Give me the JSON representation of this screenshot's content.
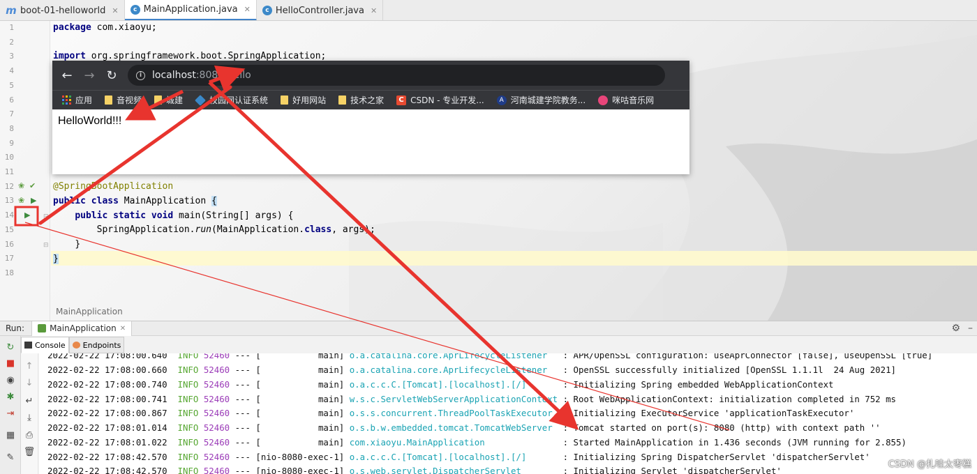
{
  "tabs": [
    {
      "label": "boot-01-helloworld",
      "icon": "maven-module-icon",
      "active": false
    },
    {
      "label": "MainApplication.java",
      "icon": "java-class-icon",
      "active": true
    },
    {
      "label": "HelloController.java",
      "icon": "java-class-icon",
      "active": false
    }
  ],
  "editor": {
    "line_numbers": [
      "1",
      "2",
      "3",
      "4",
      "5",
      "6",
      "7",
      "8",
      "9",
      "10",
      "11",
      "12",
      "13",
      "14",
      "15",
      "16",
      "17",
      "18"
    ],
    "code": {
      "l1_kw": "package",
      "l1_rest": " com.xiaoyu;",
      "l3_kw": "import",
      "l3_rest": " org.springframework.boot.SpringApplication;",
      "l12": "@SpringBootApplication",
      "l13_kw1": "public",
      "l13_kw2": "class",
      "l13_name": " MainApplication ",
      "l13_brace": "{",
      "l14_kw": "public static void",
      "l14_rest": " main(String[] args) {",
      "l15_a": "SpringApplication.",
      "l15_b": "run",
      "l15_c": "(MainApplication.",
      "l15_kw": "class",
      "l15_d": ", args);",
      "l16": "}",
      "l17": "}"
    },
    "breadcrumb": "MainApplication"
  },
  "browser": {
    "url_host": "localhost",
    "url_path": ":8080/hello",
    "bookmarks": [
      "应用",
      "音视频",
      "城建",
      "校园网认证系统",
      "好用网站",
      "技术之家",
      "CSDN - 专业开发...",
      "河南城建学院教务...",
      "咪咕音乐网"
    ],
    "page_text": "HelloWorld!!!"
  },
  "run_panel": {
    "label": "Run:",
    "config_tab": "MainApplication",
    "console_tab": "Console",
    "endpoints_tab": "Endpoints"
  },
  "console": {
    "lines": [
      {
        "ts": "2022-02-22 17:08:00.640",
        "level": "INFO",
        "pid": "52460",
        "sep": " --- [",
        "thread": "           main]",
        "logger": "o.a.catalina.core.AprLifecycleListener  ",
        "msg": " : APR/OpenSSL configuration: useAprConnector [false], useOpenSSL [true]"
      },
      {
        "ts": "2022-02-22 17:08:00.660",
        "level": "INFO",
        "pid": "52460",
        "sep": " --- [",
        "thread": "           main]",
        "logger": "o.a.catalina.core.AprLifecycleListener  ",
        "msg": " : OpenSSL successfully initialized [OpenSSL 1.1.1l  24 Aug 2021]"
      },
      {
        "ts": "2022-02-22 17:08:00.740",
        "level": "INFO",
        "pid": "52460",
        "sep": " --- [",
        "thread": "           main]",
        "logger": "o.a.c.c.C.[Tomcat].[localhost].[/]      ",
        "msg": " : Initializing Spring embedded WebApplicationContext"
      },
      {
        "ts": "2022-02-22 17:08:00.741",
        "level": "INFO",
        "pid": "52460",
        "sep": " --- [",
        "thread": "           main]",
        "logger": "w.s.c.ServletWebServerApplicationContext",
        "msg": " : Root WebApplicationContext: initialization completed in 752 ms"
      },
      {
        "ts": "2022-02-22 17:08:00.867",
        "level": "INFO",
        "pid": "52460",
        "sep": " --- [",
        "thread": "           main]",
        "logger": "o.s.s.concurrent.ThreadPoolTaskExecutor ",
        "msg": " : Initializing ExecutorService 'applicationTaskExecutor'"
      },
      {
        "ts": "2022-02-22 17:08:01.014",
        "level": "INFO",
        "pid": "52460",
        "sep": " --- [",
        "thread": "           main]",
        "logger": "o.s.b.w.embedded.tomcat.TomcatWebServer ",
        "msg": " : Tomcat started on port(s): 8080 (http) with context path ''"
      },
      {
        "ts": "2022-02-22 17:08:01.022",
        "level": "INFO",
        "pid": "52460",
        "sep": " --- [",
        "thread": "           main]",
        "logger": "com.xiaoyu.MainApplication              ",
        "msg": " : Started MainApplication in 1.436 seconds (JVM running for 2.855)"
      },
      {
        "ts": "2022-02-22 17:08:42.570",
        "level": "INFO",
        "pid": "52460",
        "sep": " --- [",
        "thread": "nio-8080-exec-1]",
        "logger": "o.a.c.c.C.[Tomcat].[localhost].[/]      ",
        "msg": " : Initializing Spring DispatcherServlet 'dispatcherServlet'"
      },
      {
        "ts": "2022-02-22 17:08:42.570",
        "level": "INFO",
        "pid": "52460",
        "sep": " --- [",
        "thread": "nio-8080-exec-1]",
        "logger": "o.s.web.servlet.DispatcherServlet       ",
        "msg": " : Initializing Servlet 'dispatcherServlet'"
      }
    ]
  },
  "watermark": "CSDN @扎哇太枣糕",
  "colors": {
    "annotation_red": "#e8342e",
    "keyword": "#000080",
    "annotation": "#808000",
    "log_level": "#55a630",
    "log_pid": "#9b3cb8",
    "log_logger": "#1aa3b3"
  }
}
